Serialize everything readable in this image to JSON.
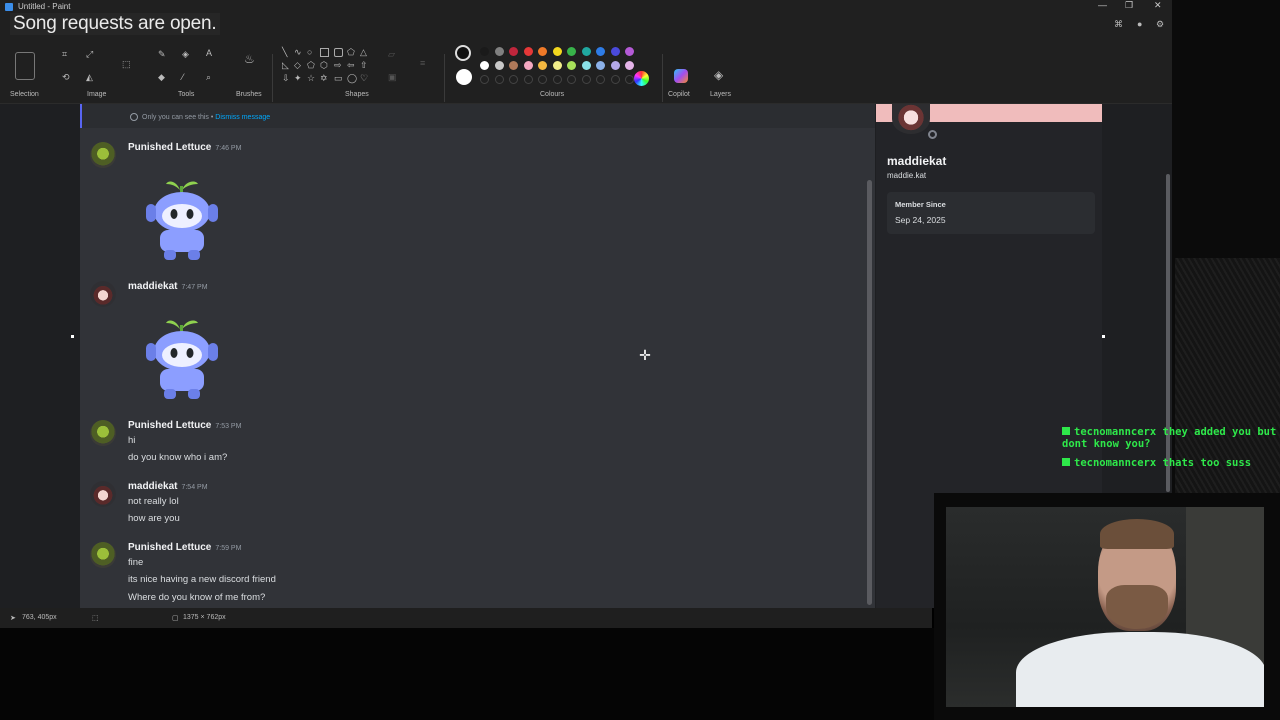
{
  "window": {
    "title": "Untitled - Paint",
    "controls": [
      "—",
      "❐",
      "✕"
    ]
  },
  "overlay": {
    "song_requests": "Song requests are open."
  },
  "ribbon": {
    "groups": {
      "selection": "Selection",
      "image": "Image",
      "tools": "Tools",
      "brushes": "Brushes",
      "shapes": "Shapes",
      "colours": "Colours",
      "copilot": "Copilot",
      "layers": "Layers"
    },
    "colours_row1": [
      "#1a1a1a",
      "#808080",
      "#c0263c",
      "#e63838",
      "#f07a28",
      "#f4d81e",
      "#38b34a",
      "#20a8a0",
      "#2e7ce6",
      "#4a4adc",
      "#b45ad6"
    ],
    "colours_row2": [
      "#ffffff",
      "#c8c8c8",
      "#b07a5a",
      "#f4a8c0",
      "#f4b840",
      "#f2ee8a",
      "#a8e05a",
      "#8ae0e8",
      "#8ab0e8",
      "#b4a8e8",
      "#e4b4e8"
    ]
  },
  "chat": {
    "notice": {
      "text": "Only you can see this •",
      "link": "Dismiss message"
    },
    "messages": [
      {
        "author": "Punished Lettuce",
        "time": "7:46 PM",
        "lines": [],
        "sticker": "wumpus-sprout-sticker"
      },
      {
        "author": "maddiekat",
        "time": "7:47 PM",
        "lines": [],
        "sticker": "wumpus-sprout-sticker"
      },
      {
        "author": "Punished Lettuce",
        "time": "7:53 PM",
        "lines": [
          "hi",
          "do you know who i am?"
        ]
      },
      {
        "author": "maddiekat",
        "time": "7:54 PM",
        "lines": [
          "not really lol",
          "how are you"
        ]
      },
      {
        "author": "Punished Lettuce",
        "time": "7:59 PM",
        "lines": [
          "fine",
          "its nice having a new discord friend",
          "Where do you know of me from?"
        ]
      }
    ]
  },
  "profile": {
    "display_name": "maddiekat",
    "username": "maddie.kat",
    "member_since_label": "Member Since",
    "member_since": "Sep 24, 2025"
  },
  "statusbar": {
    "cursor_pos": "763, 405px",
    "canvas_size": "1375 × 762px"
  },
  "stream_chat": [
    {
      "user": "tecnomanncerx",
      "text": "they added you but dont know you?"
    },
    {
      "user": "tecnomanncerx",
      "text": "thats too suss"
    }
  ]
}
